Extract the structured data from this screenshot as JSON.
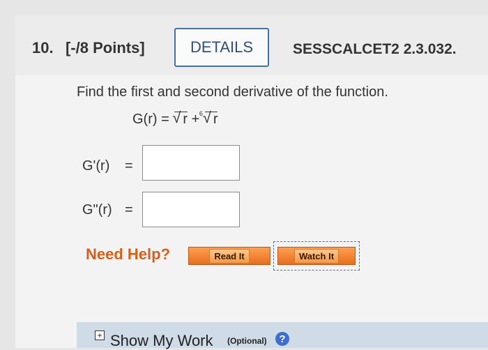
{
  "question": {
    "number": "10.",
    "points": "[-/8 Points]",
    "details_label": "DETAILS",
    "code": "SESSCALCET2 2.3.032."
  },
  "prompt": "Find the first and second derivative of the function.",
  "function": {
    "lhs": "G(r) = ",
    "radicand1": "r",
    "plus": " + ",
    "root_index": "6",
    "radicand2": "r"
  },
  "answers": [
    {
      "label": "G'(r)",
      "equals": "=",
      "value": ""
    },
    {
      "label": "G\"(r)",
      "equals": "=",
      "value": ""
    }
  ],
  "help": {
    "label": "Need Help?",
    "read_it": "Read It",
    "watch_it": "Watch It"
  },
  "show_work": {
    "toggle": "+",
    "label": "Show My Work",
    "optional": "(Optional)",
    "help_icon": "?"
  }
}
